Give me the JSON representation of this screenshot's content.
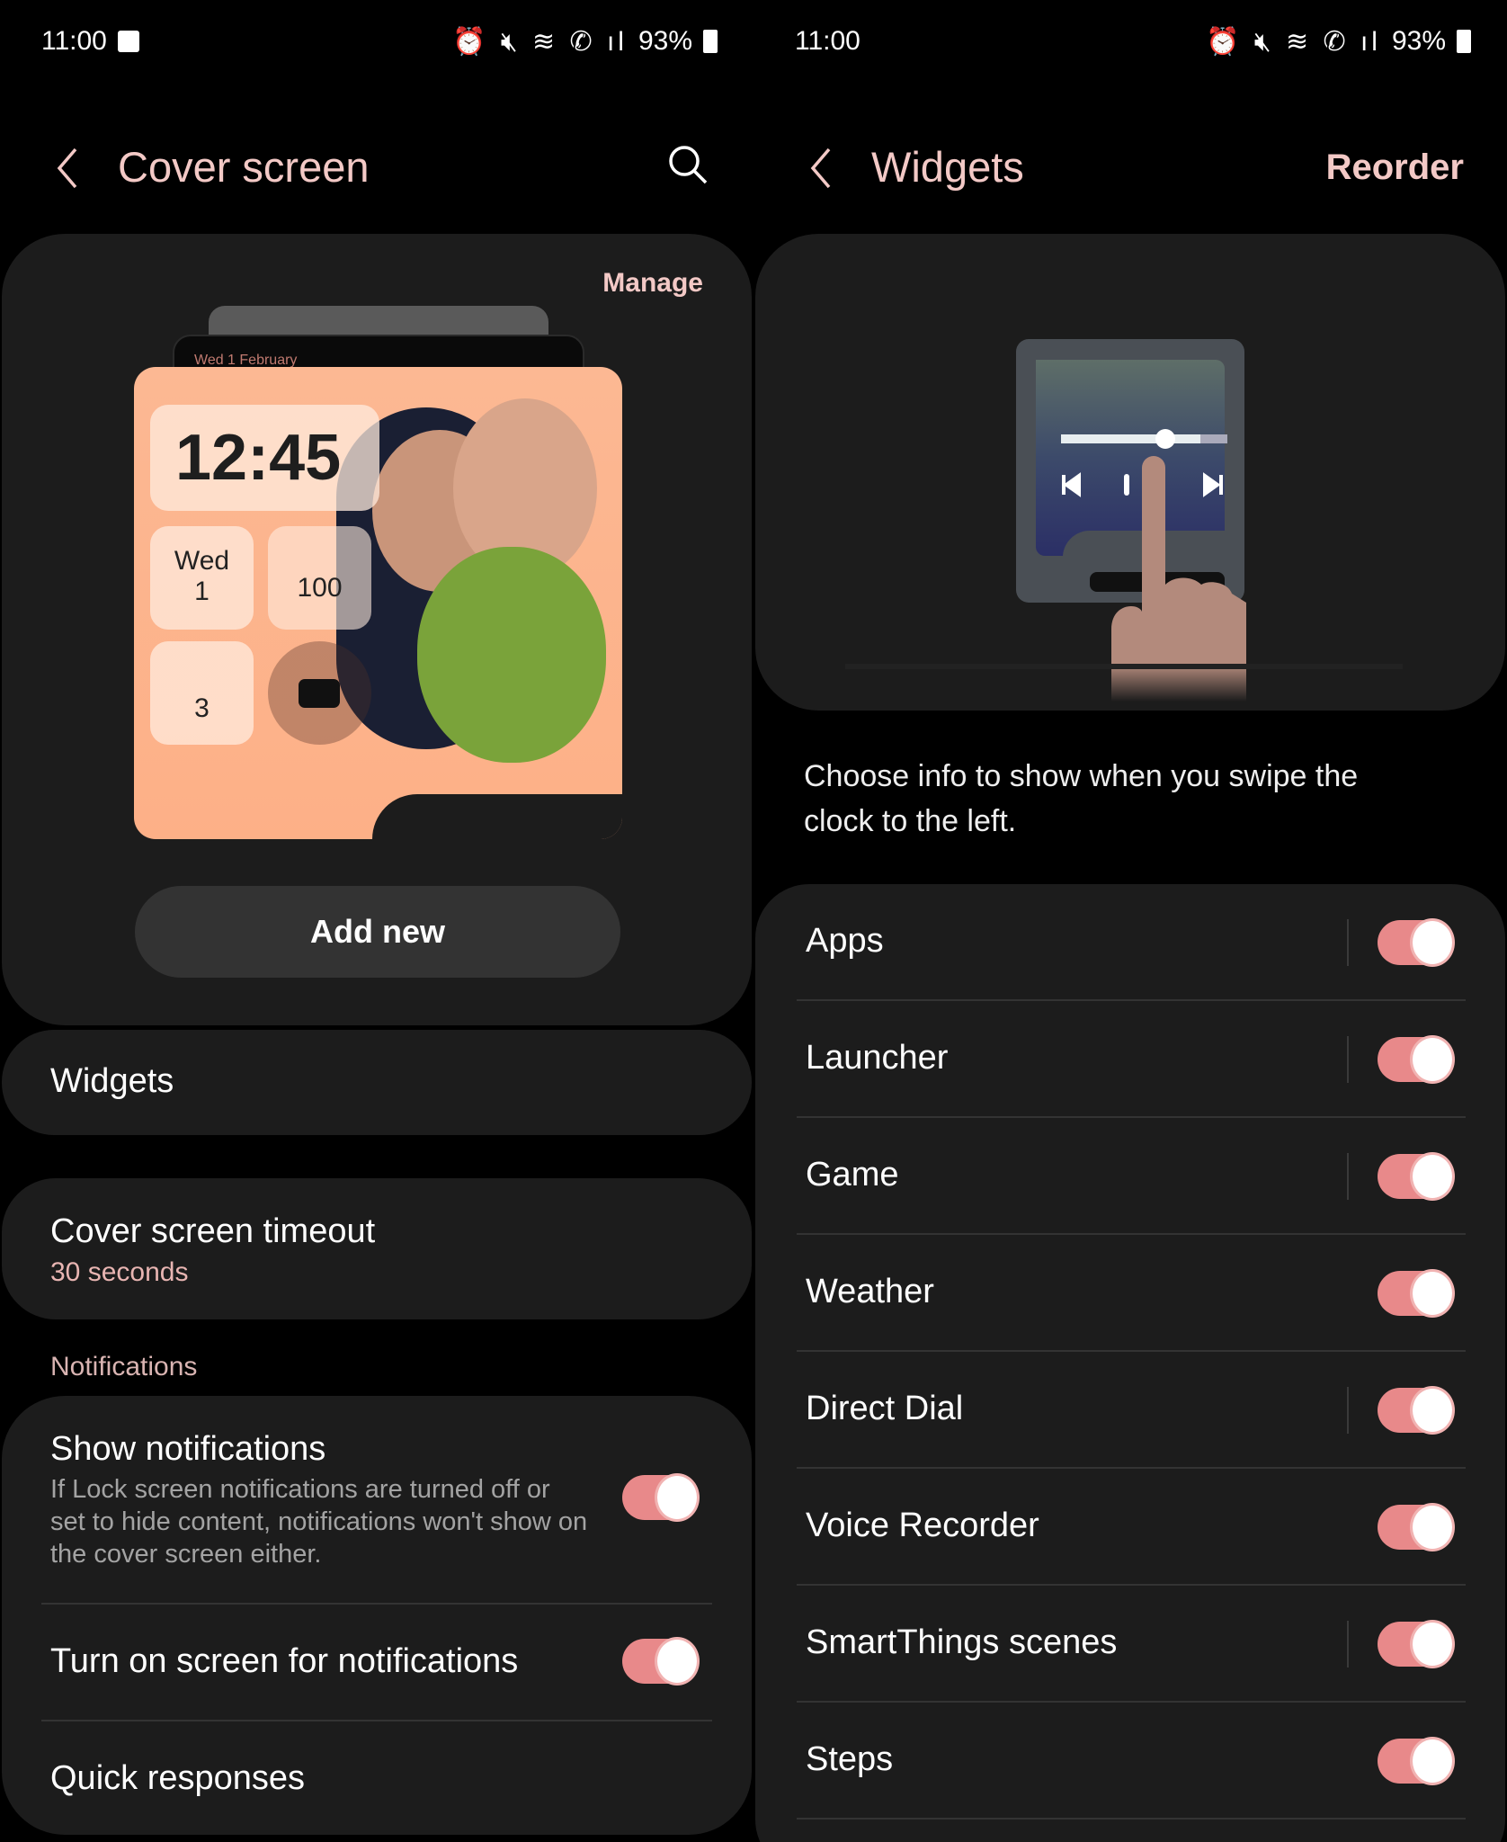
{
  "status": {
    "time": "11:00",
    "battery": "93%",
    "icons": [
      "gallery-icon",
      "alarm-icon",
      "mute-icon",
      "wifi-icon",
      "wifi-calling-icon",
      "signal-icon",
      "battery-charging-icon"
    ]
  },
  "left": {
    "title": "Cover screen",
    "manage": "Manage",
    "preview": {
      "date": "Wed 1 February",
      "clock": "12:45",
      "day": "Wed",
      "daynum": "1",
      "battery": "100",
      "notif_count": "3"
    },
    "add_new": "Add new",
    "widgets": "Widgets",
    "timeout": {
      "title": "Cover screen timeout",
      "value": "30 seconds"
    },
    "section": "Notifications",
    "show_notifications": {
      "title": "Show notifications",
      "desc": "If Lock screen notifications are turned off or set to hide content, notifications won't show on the cover screen either.",
      "on": true
    },
    "turn_on_screen": {
      "title": "Turn on screen for notifications",
      "on": true
    },
    "quick_responses": "Quick responses"
  },
  "right": {
    "title": "Widgets",
    "reorder": "Reorder",
    "description": "Choose info to show when you swipe the clock to the left.",
    "items": [
      {
        "label": "Apps",
        "on": true,
        "settings": true
      },
      {
        "label": "Launcher",
        "on": true,
        "settings": true
      },
      {
        "label": "Game",
        "on": true,
        "settings": true
      },
      {
        "label": "Weather",
        "on": true,
        "settings": false
      },
      {
        "label": "Direct Dial",
        "on": true,
        "settings": true
      },
      {
        "label": "Voice Recorder",
        "on": true,
        "settings": false
      },
      {
        "label": "SmartThings scenes",
        "on": true,
        "settings": true
      },
      {
        "label": "Steps",
        "on": true,
        "settings": false
      }
    ]
  },
  "colors": {
    "accent": "#f3c9c6",
    "toggle": "#e8898a",
    "card": "#1c1c1c",
    "background": "#000000"
  }
}
